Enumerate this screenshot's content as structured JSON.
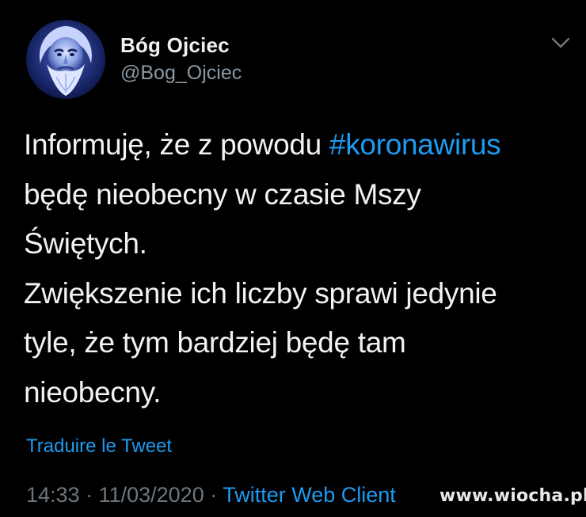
{
  "tweet": {
    "display_name": "Bóg Ojciec",
    "handle": "@Bog_Ojciec",
    "text_before": "Informuję, że z powodu ",
    "hashtag": "#koronawirus",
    "text_after": "\nbędę nieobecny w czasie Mszy\nŚwiętych.\nZwiększenie ich liczby sprawi jedynie\ntyle, że tym bardziej będę tam\nnieobecny.",
    "translate_label": "Traduire le Tweet",
    "time": "14:33",
    "date": "11/03/2020",
    "separator": " · ",
    "client": "Twitter Web Client"
  },
  "icons": {
    "menu": "chevron-down-icon"
  },
  "watermark": "www.wiocha.pl",
  "colors": {
    "background": "#000000",
    "accent": "#1d9bf0",
    "secondary_text": "#6e767d"
  }
}
